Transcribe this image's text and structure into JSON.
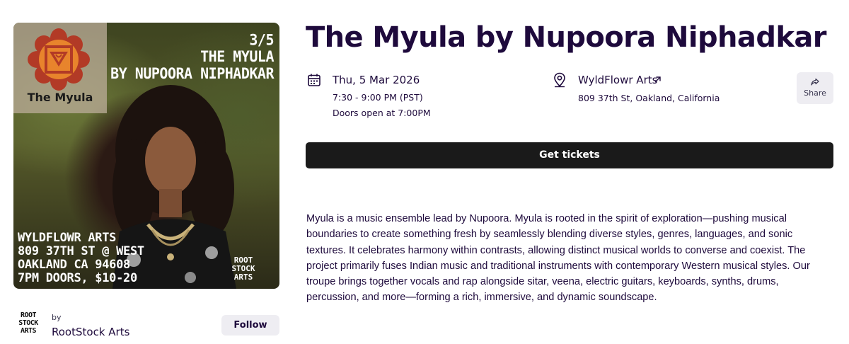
{
  "poster": {
    "logo_name": "The Myula",
    "title_lines": [
      "3/5",
      "THE MYULA",
      "BY NUPOORA NIPHADKAR"
    ],
    "venue_lines": [
      "WYLDFLOWR ARTS",
      "809 37TH ST @ WEST",
      "OAKLAND CA 94608",
      "7PM DOORS, $10-20"
    ],
    "stamp_lines": [
      "ROOT",
      "STOCK",
      "ARTS"
    ]
  },
  "organizer": {
    "logo_lines": [
      "ROOT",
      "STOCK",
      "ARTS"
    ],
    "by_label": "by",
    "name": "RootStock Arts",
    "follow_label": "Follow"
  },
  "event": {
    "title": "The Myula by Nupoora Niphadkar",
    "date": "Thu, 5 Mar 2026",
    "time": "7:30 - 9:00 PM (PST)",
    "doors": "Doors open at 7:00PM",
    "venue_name": "WyldFlowr Arts",
    "venue_address": "809 37th St, Oakland, California",
    "share_label": "Share",
    "tickets_label": "Get tickets",
    "description": "Myula is a music ensemble lead by Nupoora. Myula is rooted in the spirit of exploration—pushing musical boundaries to create something fresh by seamlessly blending diverse styles, genres, languages, and sonic textures. It celebrates harmony within contrasts, allowing distinct musical worlds to converse and coexist. The project primarily fuses Indian music and traditional instruments with contemporary Western musical styles. Our troupe brings together vocals and rap alongside sitar, veena, electric guitars, keyboards, synths, drums, percussion, and more—forming a rich, immersive, and dynamic soundscape."
  },
  "icons": {
    "calendar": "calendar-icon",
    "location": "location-pin-icon",
    "external": "external-link-icon",
    "share": "share-icon"
  },
  "colors": {
    "text": "#1e0a3c",
    "button_dark": "#1a1a1a",
    "button_light": "#eeedf2",
    "logo_red": "#b23a26",
    "logo_orange": "#e8842c"
  }
}
